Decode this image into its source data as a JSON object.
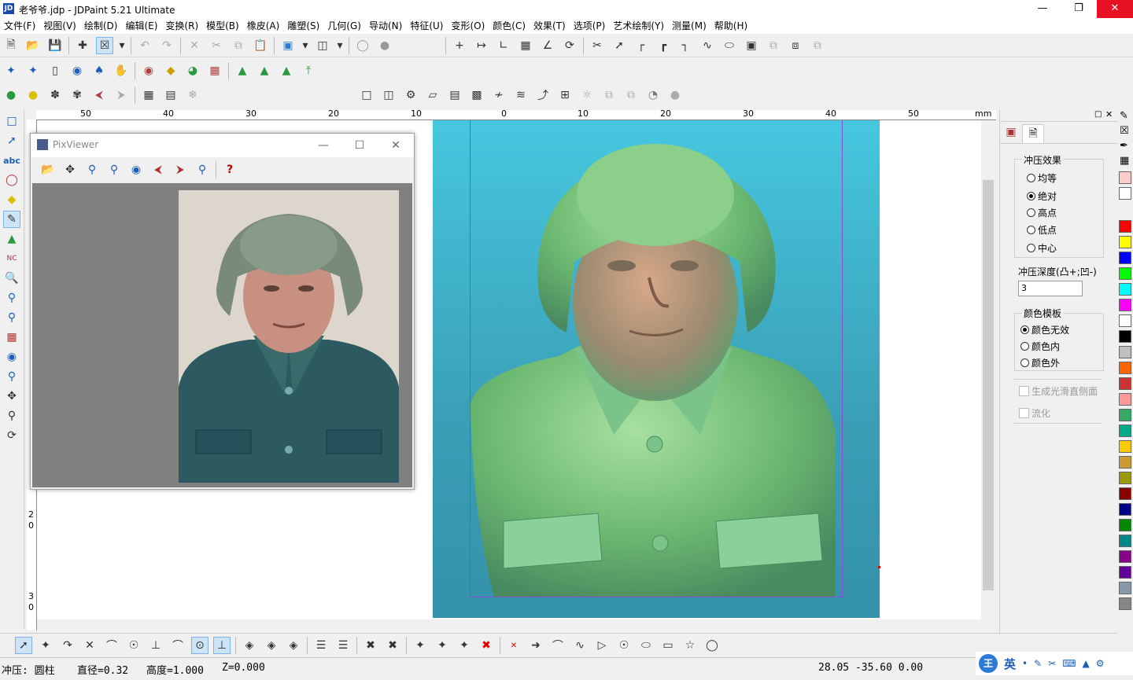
{
  "window": {
    "title": "老爷爷.jdp - JDPaint 5.21 Ultimate",
    "app_icon": "jdpaint-icon"
  },
  "menu": [
    "文件(F)",
    "视图(V)",
    "绘制(D)",
    "编辑(E)",
    "变换(R)",
    "模型(B)",
    "橡皮(A)",
    "雕塑(S)",
    "几何(G)",
    "导动(N)",
    "特征(U)",
    "变形(O)",
    "颜色(C)",
    "效果(T)",
    "选项(P)",
    "艺术绘制(Y)",
    "测量(M)",
    "帮助(H)"
  ],
  "ruler": {
    "h_labels": [
      "50",
      "40",
      "30",
      "20",
      "10",
      "0",
      "10",
      "20",
      "30",
      "40",
      "50"
    ],
    "h_unit": "mm",
    "v_labels": [
      "2",
      "0",
      "3",
      "0"
    ]
  },
  "pixviewer": {
    "title": "PixViewer"
  },
  "panel": {
    "stamp_group": "冲压效果",
    "stamp_options": [
      "均等",
      "绝对",
      "高点",
      "低点",
      "中心"
    ],
    "stamp_selected": "绝对",
    "depth_label": "冲压深度(凸+;凹-)",
    "depth_value": "3",
    "color_group": "颜色模板",
    "color_options": [
      "颜色无效",
      "颜色内",
      "颜色外"
    ],
    "color_selected": "颜色无效",
    "check_smooth": "生成光滑直侧面",
    "check_flow": "流化"
  },
  "palette": [
    "#ffcccc",
    "#ffffff",
    "#ff0000",
    "#ffff00",
    "#0000ff",
    "#00ff00",
    "#00ffff",
    "#ff00ff",
    "#ffffff",
    "#000000",
    "#c0c0c0",
    "#ff6600",
    "#cc3333",
    "#ff9999",
    "#33aa66",
    "#00aa88",
    "#ffcc00",
    "#cc9933",
    "#999900",
    "#880000",
    "#000088",
    "#008800",
    "#008888",
    "#880088",
    "#660099",
    "#8899aa",
    "#888888"
  ],
  "status": {
    "mode": "冲压: 圆柱",
    "diameter": "直径=0.32",
    "height": "高度=1.000",
    "z": "Z=0.000",
    "coords": "28.05 -35.60 0.00"
  },
  "ime": {
    "logo": "王",
    "lang": "英"
  }
}
